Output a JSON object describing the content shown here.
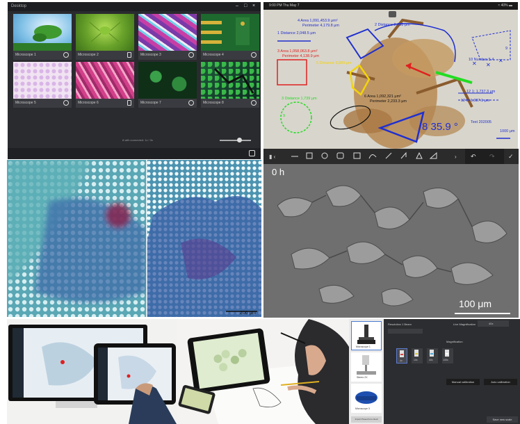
{
  "app": {
    "window_title": "Desktop",
    "window_controls": [
      "–",
      "□",
      "×"
    ],
    "cards": [
      {
        "label": "Microscope 1"
      },
      {
        "label": "Microscope 2"
      },
      {
        "label": "Microscope 3"
      },
      {
        "label": "Microscope 4"
      },
      {
        "label": "Microscope 5"
      },
      {
        "label": "Microscope 6"
      },
      {
        "label": "Microscope 7"
      },
      {
        "label": "Microscope 8"
      }
    ],
    "status_footer": "8 with connected: 1x / 3x"
  },
  "measure": {
    "status_left": "9:00 PM  Thu May 7",
    "status_right": "≈ 40% ▬",
    "labels": {
      "area1": "4 Area 1,091,453.9 μm²",
      "perim1": "Perimeter 4,179.8 μm",
      "dist1": "1 Distance 2,048.5 μm",
      "dist2": "2 Distance 2,738 μm",
      "area2": "3 Area 1,058,063.8 μm²",
      "perim2": "Perimeter 4,138.9 μm",
      "dist3": "5 Distance 3,889 μm",
      "area3": "6 Area 1,092,321 μm²",
      "perim3": "Perimeter 2,233.3 μm",
      "dist4": "3 Distance 1,739 μm",
      "num": "10 Number 5.4",
      "dist5": "12 1: 1,737.3 μm",
      "dist6": "12 0: 1,087.1 μm",
      "text": "Text 202005",
      "angle": "8 35.9 °",
      "scale": "1000 μm",
      "marker9": "9",
      "marker7": "9"
    }
  },
  "split_view": {
    "scale_label": "200 μm"
  },
  "cells": {
    "time_label": "0 h",
    "scale_label": "100 μm"
  },
  "calibration": {
    "top_labels": [
      "Resolution",
      "1 Beam",
      "Live Magnification",
      "40x"
    ],
    "magnification_label": "Magnification",
    "objectives": [
      "4x",
      "10x",
      "40x",
      "100x"
    ],
    "manual_button": "Manual calibration",
    "auto_button": "Auto calibration",
    "side_items": [
      "Microscope 1",
      "Stereo 2X",
      "Microscope 3"
    ],
    "bottom_left_button": "Import Preset from cloud",
    "bottom_right_button": "Save new scale"
  },
  "colors": {
    "app_bg": "#2a2b2f",
    "measure_blue": "#1f2fd0",
    "measure_red": "#e02020",
    "measure_yellow": "#f2d40a",
    "measure_green": "#22dd22"
  }
}
